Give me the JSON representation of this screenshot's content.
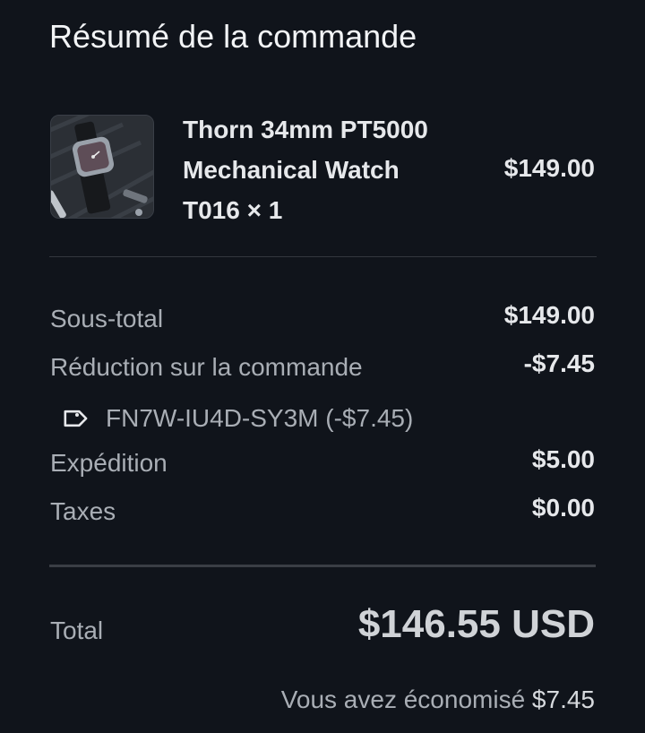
{
  "header": {
    "title": "Résumé de la commande"
  },
  "item": {
    "name_line1": "Thorn 34mm PT5000",
    "name_line2": "Mechanical Watch",
    "variant_qty": "T016 × 1",
    "price": "$149.00",
    "thumbnail_icon": "watch-image"
  },
  "summary": {
    "subtotal_label": "Sous-total",
    "subtotal_value": "$149.00",
    "discount_label": "Réduction sur la commande",
    "discount_value": "-$7.45",
    "discount_code": "FN7W-IU4D-SY3M (-$7.45)",
    "discount_icon": "tag-icon",
    "shipping_label": "Expédition",
    "shipping_value": "$5.00",
    "taxes_label": "Taxes",
    "taxes_value": "$0.00"
  },
  "total": {
    "label": "Total",
    "value": "$146.55 USD",
    "savings_label": "Vous avez économisé",
    "savings_value": "$7.45"
  }
}
